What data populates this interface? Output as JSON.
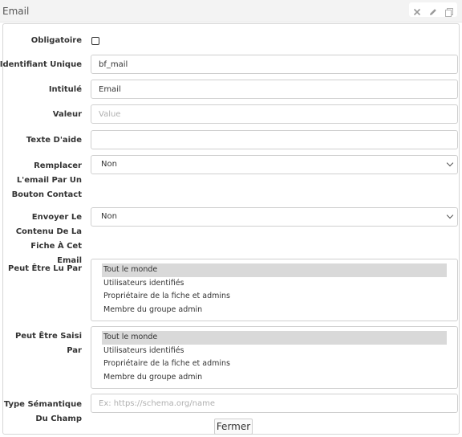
{
  "panel": {
    "title": "Email",
    "tools": [
      "close-icon",
      "pencil-icon",
      "copy-icon"
    ]
  },
  "form": {
    "obligatoire": {
      "label": "Obligatoire",
      "checked": false
    },
    "identifiant": {
      "label": "Identifiant Unique",
      "value": "bf_mail"
    },
    "intitule": {
      "label": "Intitulé",
      "value": "Email"
    },
    "valeur": {
      "label": "Valeur",
      "value": "",
      "placeholder": "Value"
    },
    "texte_aide": {
      "label": "Texte D'aide",
      "value": ""
    },
    "remplacer": {
      "label": "Remplacer L'email Par Un Bouton Contact",
      "value": "Non"
    },
    "envoyer": {
      "label": "Envoyer Le Contenu De La Fiche À Cet Email",
      "value": "Non"
    },
    "lu_par": {
      "label": "Peut Être Lu Par",
      "options": [
        "Tout le monde",
        "Utilisateurs identifiés",
        "Propriétaire de la fiche et admins",
        "Membre du groupe admin"
      ],
      "selected": "Tout le monde"
    },
    "saisi_par": {
      "label": "Peut Être Saisi Par",
      "options": [
        "Tout le monde",
        "Utilisateurs identifiés",
        "Propriétaire de la fiche et admins",
        "Membre du groupe admin"
      ],
      "selected": "Tout le monde"
    },
    "type_semantique": {
      "label": "Type Sémantique Du Champ",
      "value": "",
      "placeholder": "Ex: https://schema.org/name"
    }
  },
  "close_label": "Fermer"
}
